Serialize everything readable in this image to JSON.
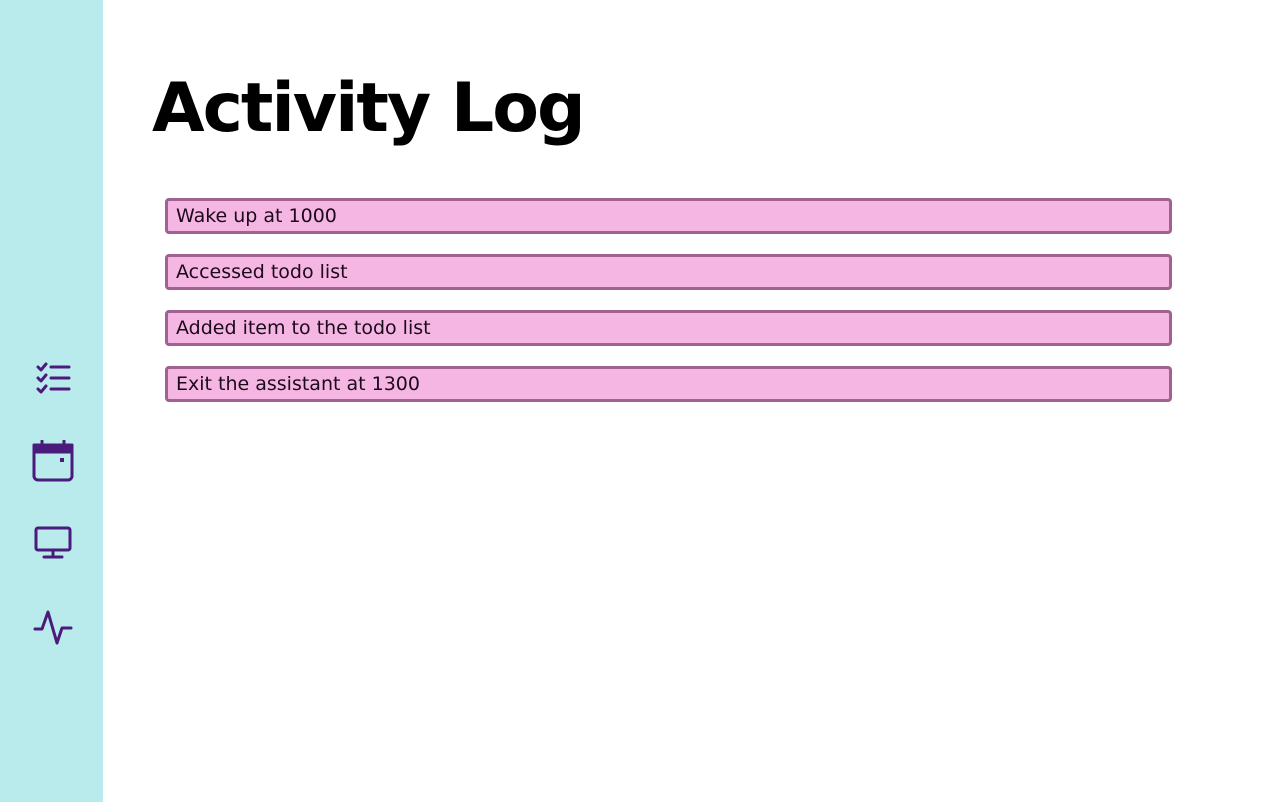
{
  "sidebar": {
    "items": [
      {
        "icon": "checklist-icon"
      },
      {
        "icon": "calendar-icon"
      },
      {
        "icon": "monitor-icon"
      },
      {
        "icon": "activity-icon"
      }
    ],
    "icon_color": "#4b1a7d",
    "background": "#b9eaec"
  },
  "main": {
    "title": "Activity Log",
    "entries": [
      "Wake up at 1000",
      "Accessed todo list",
      "Added item to the todo list",
      "Exit the assistant at 1300"
    ],
    "entry_background": "#f6b6e3",
    "entry_border": "#a0628f"
  }
}
